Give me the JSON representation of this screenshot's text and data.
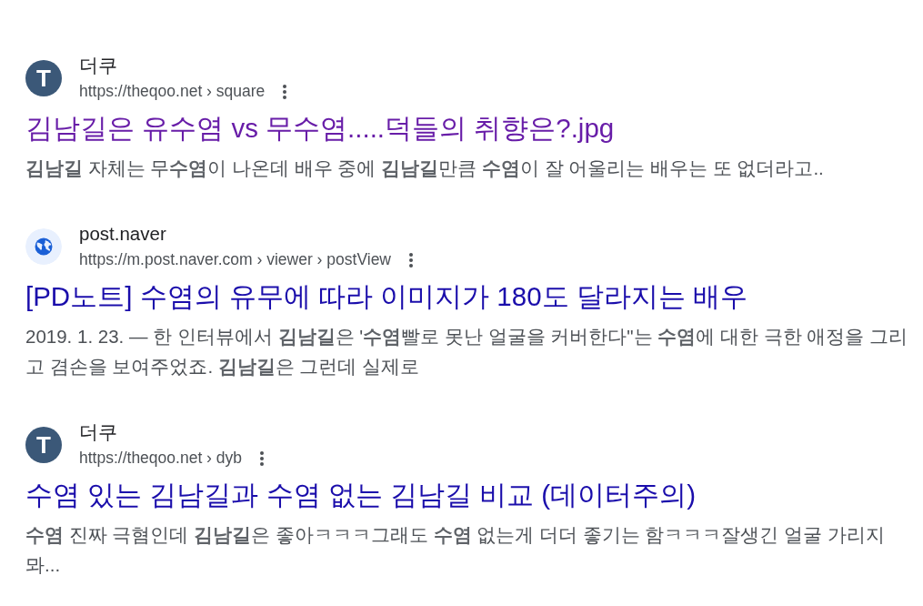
{
  "results": [
    {
      "favicon": {
        "kind": "letter",
        "letter": "T"
      },
      "site_name": "더쿠",
      "url": "https://theqoo.net › square",
      "title": "김남길은 유수염 vs 무수염.....덕들의 취향은?.jpg",
      "visited": true,
      "snippet": "**김남길** 자체는 무**수염**이 나온데 배우 중에 **김남길**만큼 **수염**이 잘 어울리는 배우는 또 없더라고.."
    },
    {
      "favicon": {
        "kind": "globe"
      },
      "site_name": "post.naver",
      "url": "https://m.post.naver.com › viewer › postView",
      "title": "[PD노트] 수염의 유무에 따라 이미지가 180도 달라지는 배우",
      "visited": false,
      "snippet": "2019. 1. 23. — 한 인터뷰에서 **김남길**은 '**수염**빨로 못난 얼굴을 커버한다\"는 **수염**에 대한 극한 애정을 그리고 겸손을 보여주었죠. **김남길**은 그런데 실제로"
    },
    {
      "favicon": {
        "kind": "letter",
        "letter": "T"
      },
      "site_name": "더쿠",
      "url": "https://theqoo.net › dyb",
      "title": "수염 있는 김남길과 수염 없는 김남길 비교 (데이터주의)",
      "visited": false,
      "snippet": "**수염** 진짜 극혐인데 **김남길**은 좋아ㅋㅋㅋ그래도 **수염** 없는게 더더 좋기는 함ㅋㅋㅋ잘생긴 얼굴 가리지 뫄..."
    }
  ]
}
